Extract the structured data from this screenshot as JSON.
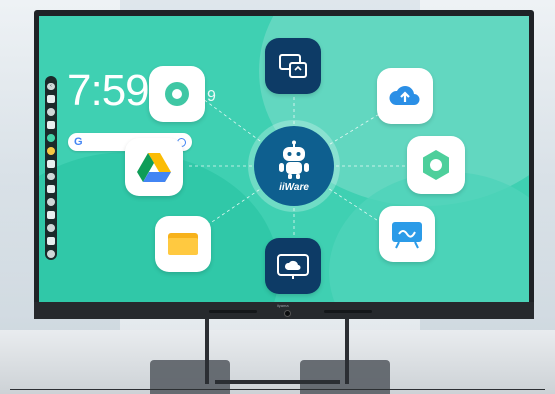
{
  "home": {
    "clock": "7:59",
    "clock_partial": "9"
  },
  "search": {
    "logo": "G"
  },
  "hub": {
    "label": "iiWare"
  },
  "monitor": {
    "brand": "iiyama"
  },
  "tiles": [
    {
      "icon": "screen-share-icon"
    },
    {
      "icon": "cloud-upload-icon"
    },
    {
      "icon": "settings-icon"
    },
    {
      "icon": "whiteboard-icon"
    },
    {
      "icon": "cloud-display-icon"
    },
    {
      "icon": "file-folder-icon"
    },
    {
      "icon": "google-drive-icon"
    },
    {
      "icon": "app-launcher-icon"
    }
  ],
  "colors": {
    "screen_bg": "#3fd0b2",
    "hub_bg": "#0e5f8f",
    "tile_dark": "#0d3b66",
    "accent_blue": "#2b8fe6"
  }
}
